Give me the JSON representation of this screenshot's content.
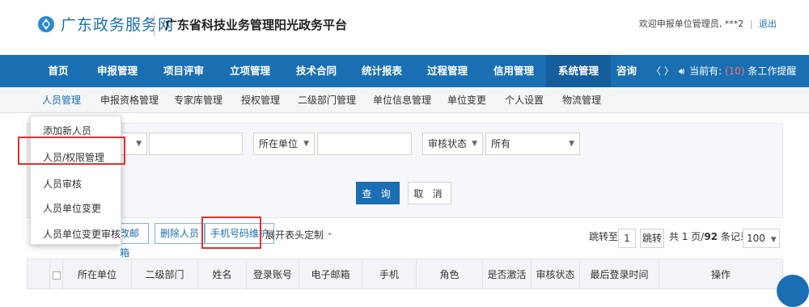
{
  "header": {
    "logo_text": "广东政务服务网",
    "platform_title": "广东省科技业务管理阳光政务平台",
    "welcome_text": "欢迎申报单位管理员,",
    "user_name": "***2",
    "logout_label": "退出"
  },
  "main_nav": [
    {
      "label": "首页"
    },
    {
      "label": "申报管理"
    },
    {
      "label": "项目评审"
    },
    {
      "label": "立项管理"
    },
    {
      "label": "技术合同"
    },
    {
      "label": "统计报表"
    },
    {
      "label": "过程管理"
    },
    {
      "label": "信用管理"
    },
    {
      "label": "系统管理"
    },
    {
      "label": "咨询"
    }
  ],
  "notice": {
    "prev_label": "〈",
    "next_label": "〉",
    "prefix": "当前有:",
    "count": "(10)",
    "suffix": "条工作提醒"
  },
  "sub_nav": [
    {
      "label": "人员管理"
    },
    {
      "label": "申报资格管理"
    },
    {
      "label": "专家库管理"
    },
    {
      "label": "授权管理"
    },
    {
      "label": "二级部门管理"
    },
    {
      "label": "单位信息管理"
    },
    {
      "label": "单位变更"
    },
    {
      "label": "个人设置"
    },
    {
      "label": "物流管理"
    }
  ],
  "filter": {
    "unit_label": "所在单位",
    "status_label": "审核状态",
    "status_value": "所有",
    "query_label": "查 询",
    "cancel_label": "取 消"
  },
  "toolbar": {
    "mail_label": "改邮箱",
    "delete_label": "删除人员",
    "phone_label": "手机号码维护",
    "expand_label": "展开表头定制"
  },
  "pager": {
    "jump_label": "跳转至",
    "page_value": "1",
    "jump_button": "跳转",
    "summary_prefix": "共 1 页/",
    "total": "92",
    "summary_suffix": " 条记录",
    "page_size": "100"
  },
  "table": {
    "columns": [
      "所在单位",
      "二级部门",
      "姓名",
      "登录账号",
      "电子邮箱",
      "手机",
      "角色",
      "是否激活",
      "审核状态",
      "最后登录时间",
      "操作"
    ]
  },
  "dropdown": {
    "items": [
      {
        "label": "添加新人员"
      },
      {
        "label": "人员/权限管理"
      },
      {
        "label": "人员审核"
      },
      {
        "label": "人员单位变更"
      },
      {
        "label": "人员单位变更审核"
      }
    ]
  },
  "colors": {
    "primary": "#1a6fb3",
    "highlight": "#e03131",
    "notice_count": "#ff6b6b"
  }
}
